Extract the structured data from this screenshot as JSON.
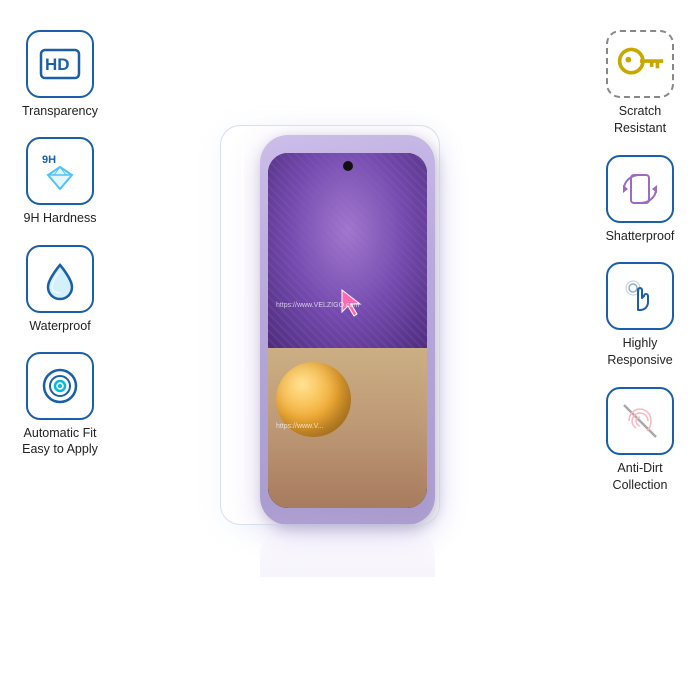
{
  "features": {
    "left": [
      {
        "id": "hd-transparency",
        "label": "Transparency",
        "icon": "hd",
        "box_style": "solid"
      },
      {
        "id": "9h-hardness",
        "label": "9H Hardness",
        "icon": "diamond",
        "box_style": "solid"
      },
      {
        "id": "waterproof",
        "label": "Waterproof",
        "icon": "droplet",
        "box_style": "solid"
      },
      {
        "id": "auto-fit",
        "label": "Automatic Fit\nEasy to Apply",
        "icon": "target",
        "box_style": "solid"
      }
    ],
    "right": [
      {
        "id": "scratch-resistant",
        "label": "Scratch\nResistant",
        "icon": "key",
        "box_style": "dashed"
      },
      {
        "id": "shatterproof",
        "label": "Shatterproof",
        "icon": "phone-rotate",
        "box_style": "solid"
      },
      {
        "id": "highly-responsive",
        "label": "Highly\nResponsive",
        "icon": "hand-touch",
        "box_style": "solid"
      },
      {
        "id": "anti-dirt",
        "label": "Anti-Dirt\nCollection",
        "icon": "fingerprint",
        "box_style": "solid"
      }
    ]
  },
  "watermark": {
    "text1": "https://www.VELZIGO.com",
    "text2": "https://www.V..."
  },
  "brand": {
    "name": "VELZIGO"
  },
  "accent_color": "#1a5fa8"
}
